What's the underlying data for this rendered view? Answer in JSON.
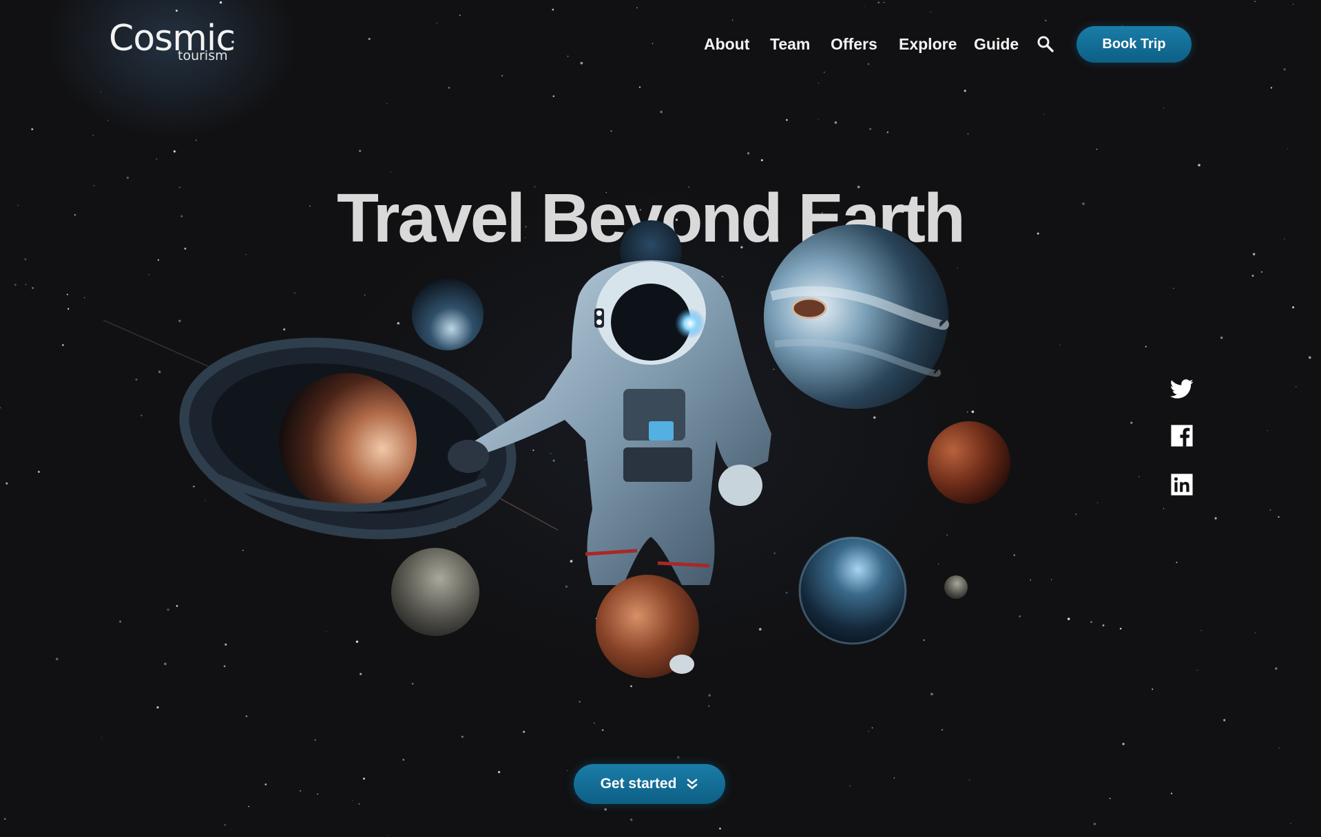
{
  "brand": {
    "logo_text": "osmic",
    "logo_initial": "C",
    "logo_subtext": "tourism"
  },
  "nav": {
    "items": [
      {
        "label": "About"
      },
      {
        "label": "Team"
      },
      {
        "label": "Offers"
      },
      {
        "label": "Explore"
      },
      {
        "label": "Guide"
      }
    ],
    "search_icon": "search-icon",
    "book_label": "Book Trip"
  },
  "hero": {
    "title": "Travel Beyond Earth",
    "cta_label": "Get started",
    "cta_icon": "double-chevron-down-icon"
  },
  "social": [
    {
      "icon": "twitter-icon"
    },
    {
      "icon": "facebook-icon"
    },
    {
      "icon": "linkedin-icon"
    }
  ],
  "colors": {
    "background": "#111113",
    "accent": "#137099",
    "title": "#d9d9d9",
    "text": "#f4f4f4"
  }
}
